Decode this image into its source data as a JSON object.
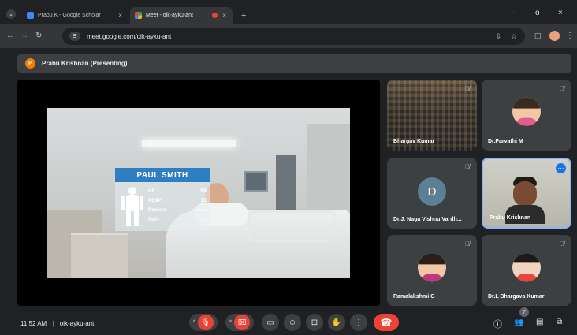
{
  "browser": {
    "tabs": [
      {
        "title": "Prabu K - Google Scholar",
        "active": false
      },
      {
        "title": "Meet - oik-ayku-ant",
        "active": true
      }
    ],
    "new_tab": "+",
    "url": "meet.google.com/oik-ayku-ant",
    "window": {
      "minimize": "–",
      "maximize": "o",
      "close": "×"
    },
    "icons": [
      "back-icon",
      "forward-icon",
      "reload-icon",
      "site-info-icon",
      "download-icon",
      "star-icon",
      "extensions-icon",
      "profile-icon",
      "menu-icon"
    ]
  },
  "meet": {
    "presenter": {
      "initial": "P",
      "label": "Prabu Krishnan (Presenting)"
    },
    "presentation": {
      "patient_name": "PAUL SMITH",
      "vitals": [
        {
          "label": "HR",
          "value": "96"
        },
        {
          "label": "RESP",
          "value": "11"
        },
        {
          "label": "Posture",
          "value": "Reclined"
        },
        {
          "label": "Falls",
          "value": "—"
        }
      ]
    },
    "participants": [
      {
        "name": "Bhargav Kumar",
        "muted": true,
        "kind": "video-crowd"
      },
      {
        "name": "Dr.Parvathi M",
        "muted": true,
        "kind": "avatar"
      },
      {
        "name": "Dr.J. Naga Vishnu Vardh...",
        "muted": true,
        "kind": "letter",
        "initial": "D"
      },
      {
        "name": "Prabu Krishnan",
        "muted": false,
        "kind": "video-self",
        "active": true
      },
      {
        "name": "Ramalakshmi G",
        "muted": true,
        "kind": "avatar"
      },
      {
        "name": "Dr.L Bhargava Kumar",
        "muted": true,
        "kind": "avatar"
      }
    ],
    "footer": {
      "time": "11:52 AM",
      "separator": "|",
      "meeting_code": "oik-ayku-ant",
      "people_count": "7"
    },
    "colors": {
      "accent_blue": "#8ab4f8",
      "hangup_red": "#ea4335",
      "tile_bg": "#3c4043",
      "bg": "#202124"
    }
  }
}
